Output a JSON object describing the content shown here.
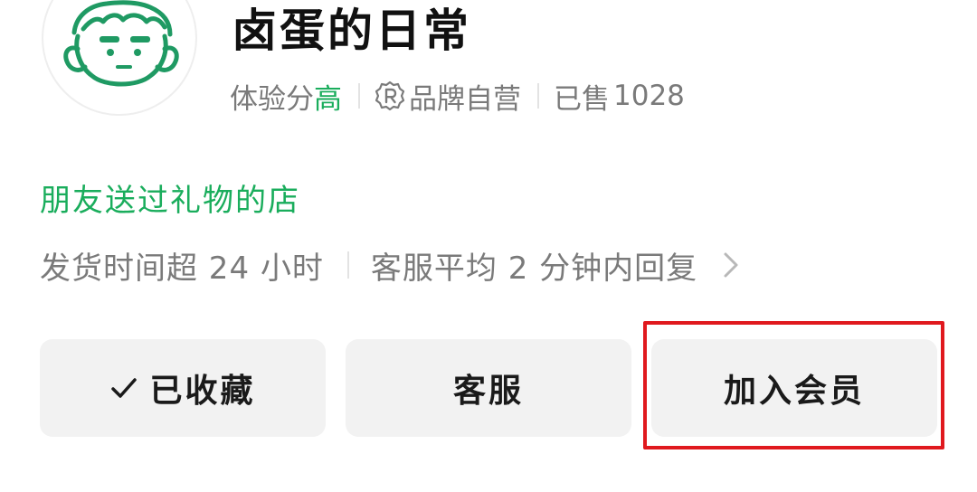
{
  "shop": {
    "name": "卤蛋的日常",
    "avatar_icon": "cartoon-face-avatar"
  },
  "meta": {
    "score_label": "体验分",
    "score_value": "高",
    "brand_label": "品牌自营",
    "brand_icon": "registered-badge-icon",
    "sold_label": "已售",
    "sold_count": "1028"
  },
  "friend_tag": "朋友送过礼物的店",
  "service": {
    "shipping": "发货时间超 24 小时",
    "response": "客服平均 2 分钟内回复",
    "chevron_icon": "chevron-right-icon"
  },
  "actions": {
    "favorite_label": "已收藏",
    "favorite_icon": "check-icon",
    "customer_service_label": "客服",
    "join_member_label": "加入会员"
  },
  "colors": {
    "accent_green": "#1aad5c",
    "highlight_red": "#e0191e",
    "button_bg": "#f2f2f2"
  }
}
